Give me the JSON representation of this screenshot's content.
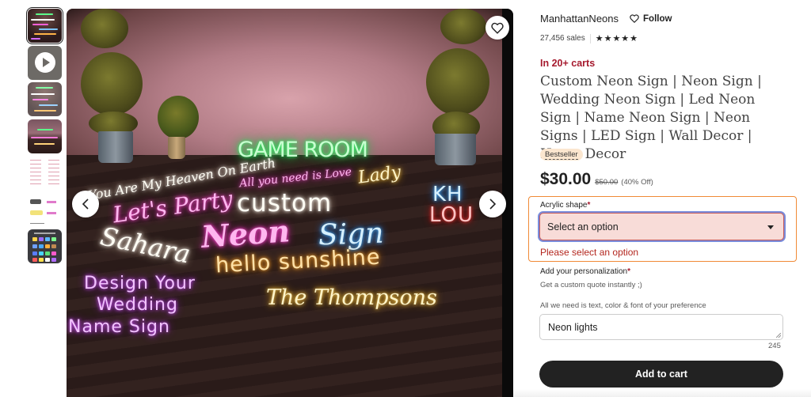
{
  "gallery": {
    "thumbnails": [
      {
        "type": "image",
        "label": "neon-signs-collage",
        "selected": true
      },
      {
        "type": "video",
        "label": "product-video"
      },
      {
        "type": "image",
        "label": "neon-signs-collage-alt"
      },
      {
        "type": "image",
        "label": "game-room-sign"
      },
      {
        "type": "image",
        "label": "font-options-chart"
      },
      {
        "type": "image",
        "label": "sign-size-examples"
      },
      {
        "type": "image",
        "label": "available-colors"
      }
    ],
    "main_image": {
      "alt": "Collection of custom neon signs on a wooden floor",
      "signs": {
        "game_room": "GAME ROOM",
        "heaven": "You Are My Heaven On Earth",
        "all_you_need": "All you need is Love",
        "lets_party": "Let's Party",
        "custom": "custom",
        "neon": "Neon",
        "sign": "Sign",
        "sahara": "Sahara",
        "hello_sunshine": "hello sunshine",
        "design_your": "Design Your",
        "wedding": "Wedding",
        "name_sign": "Name Sign",
        "thompsons": "The Thompsons",
        "kh": "KH",
        "lou": "LOU",
        "lady": "Lady"
      }
    },
    "favorite_icon": "heart-outline-icon",
    "prev_icon": "chevron-left-icon",
    "next_icon": "chevron-right-icon"
  },
  "shop": {
    "name": "ManhattanNeons",
    "follow_label": "Follow",
    "sales": "27,456 sales",
    "rating_stars": 5,
    "stars_text": "★★★★★"
  },
  "listing": {
    "in_carts": "In 20+ carts",
    "title": "Custom Neon Sign | Neon Sign | Wedding Neon Sign | Led Neon Sign | Name Neon Sign | Neon Signs | LED Sign | Wall Decor | Home Decor",
    "badge": "Bestseller",
    "price": "$30.00",
    "original_price": "$50.00",
    "discount": "(40% Off)"
  },
  "options": {
    "acrylic_shape": {
      "label": "Acrylic shape",
      "required_mark": "*",
      "selected": "Select an option",
      "error": "Please select an option"
    },
    "personalization": {
      "label": "Add your personalization",
      "required_mark": "*",
      "help_1": "Get a custom quote instantly ;)",
      "help_2": "All we need is text, color & font of your preference",
      "value": "Neon lights",
      "remaining_chars": "245"
    }
  },
  "actions": {
    "add_to_cart": "Add to cart"
  },
  "colors": {
    "accent_error": "#b3261e",
    "error_border": "#f08a36",
    "focus_ring": "#7a8ddc",
    "select_bg": "#f8dcd8",
    "cart_button": "#222222",
    "badge_bg": "#fbe6cf",
    "in_carts": "#a61a2e"
  }
}
